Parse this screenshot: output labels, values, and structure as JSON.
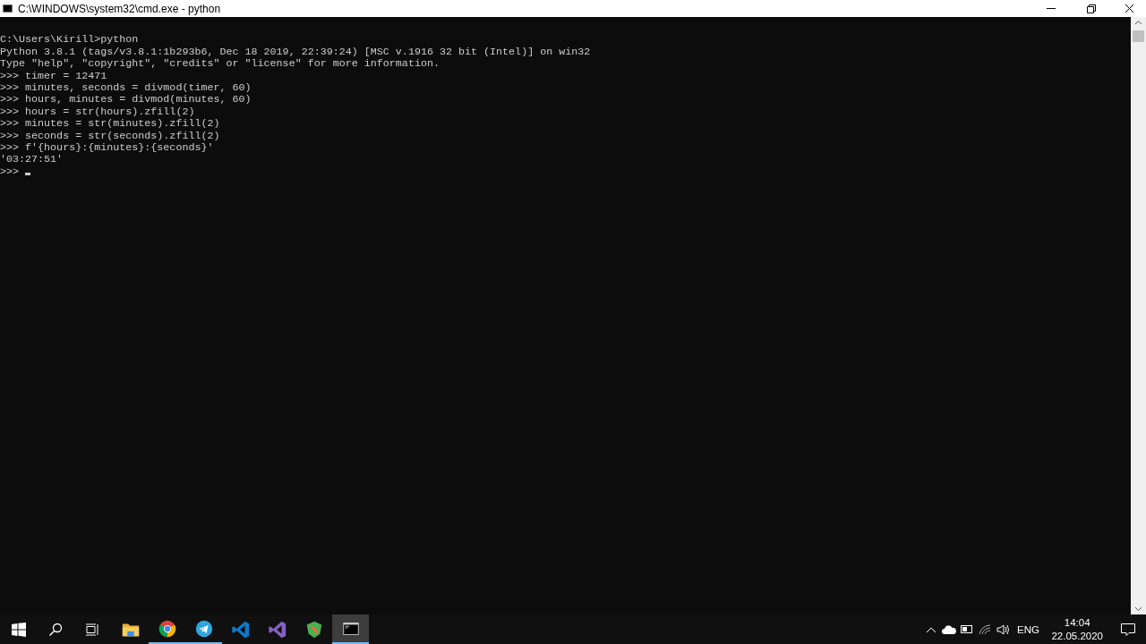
{
  "window": {
    "title": "C:\\WINDOWS\\system32\\cmd.exe - python"
  },
  "console": {
    "lines": [
      "C:\\Users\\Kirill>python",
      "Python 3.8.1 (tags/v3.8.1:1b293b6, Dec 18 2019, 22:39:24) [MSC v.1916 32 bit (Intel)] on win32",
      "Type \"help\", \"copyright\", \"credits\" or \"license\" for more information.",
      ">>> timer = 12471",
      ">>> minutes, seconds = divmod(timer, 60)",
      ">>> hours, minutes = divmod(minutes, 60)",
      ">>> hours = str(hours).zfill(2)",
      ">>> minutes = str(minutes).zfill(2)",
      ">>> seconds = str(seconds).zfill(2)",
      ">>> f'{hours}:{minutes}:{seconds}'",
      "'03:27:51'"
    ],
    "prompt": ">>>"
  },
  "taskbar": {
    "apps": [
      {
        "kind": "folder",
        "running": false,
        "selected": false
      },
      {
        "kind": "chrome",
        "running": true,
        "selected": false
      },
      {
        "kind": "telegram",
        "running": true,
        "selected": false
      },
      {
        "kind": "vscode",
        "running": false,
        "selected": false
      },
      {
        "kind": "vs",
        "running": false,
        "selected": false
      },
      {
        "kind": "leaf",
        "running": false,
        "selected": false
      },
      {
        "kind": "cmd",
        "running": true,
        "selected": true
      }
    ],
    "language": "ENG",
    "time": "14:04",
    "date": "22.05.2020"
  }
}
